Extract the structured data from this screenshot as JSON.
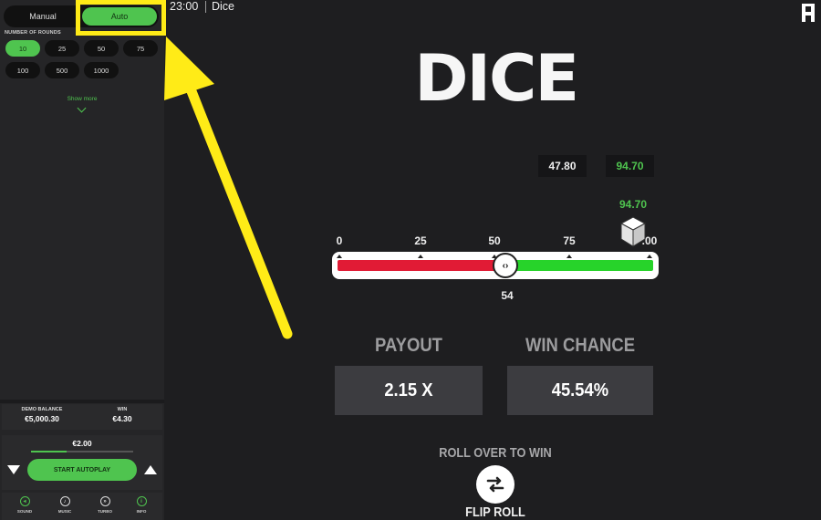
{
  "header": {
    "time": "23:00",
    "title": "Dice"
  },
  "sidebar": {
    "mode_manual": "Manual",
    "mode_auto": "Auto",
    "rounds_label": "NUMBER OF ROUNDS",
    "rounds": [
      "10",
      "25",
      "50",
      "75",
      "100",
      "500",
      "1000"
    ],
    "selected_round": "10",
    "show_more": "Show more",
    "balance_label": "DEMO BALANCE",
    "balance_value": "€5,000.30",
    "win_label": "WIN",
    "win_value": "€4.30",
    "bet_amount": "€2.00",
    "bet_level": 0.35,
    "start_label": "START AUTOPLAY",
    "nav": [
      {
        "label": "SOUND",
        "icon": "sound-icon"
      },
      {
        "label": "MUSIC",
        "icon": "music-icon"
      },
      {
        "label": "TURBO",
        "icon": "turbo-icon"
      },
      {
        "label": "INFO",
        "icon": "info-icon"
      }
    ]
  },
  "game": {
    "logo_text": "DICE",
    "history": [
      "47.80",
      "94.70"
    ],
    "last_roll": "94.70",
    "scale_labels": [
      "0",
      "25",
      "50",
      "75",
      ".00"
    ],
    "threshold": "54",
    "payout_label": "PAYOUT",
    "payout_value": "2.15 X",
    "win_chance_label": "WIN CHANCE",
    "win_chance_value": "45.54%",
    "roll_mode": "ROLL OVER TO WIN",
    "flip_label": "FLIP ROLL"
  },
  "colors": {
    "accent": "#4fc44f",
    "lose": "#e11b35",
    "win": "#27d32a",
    "highlight": "#ffeb17"
  }
}
